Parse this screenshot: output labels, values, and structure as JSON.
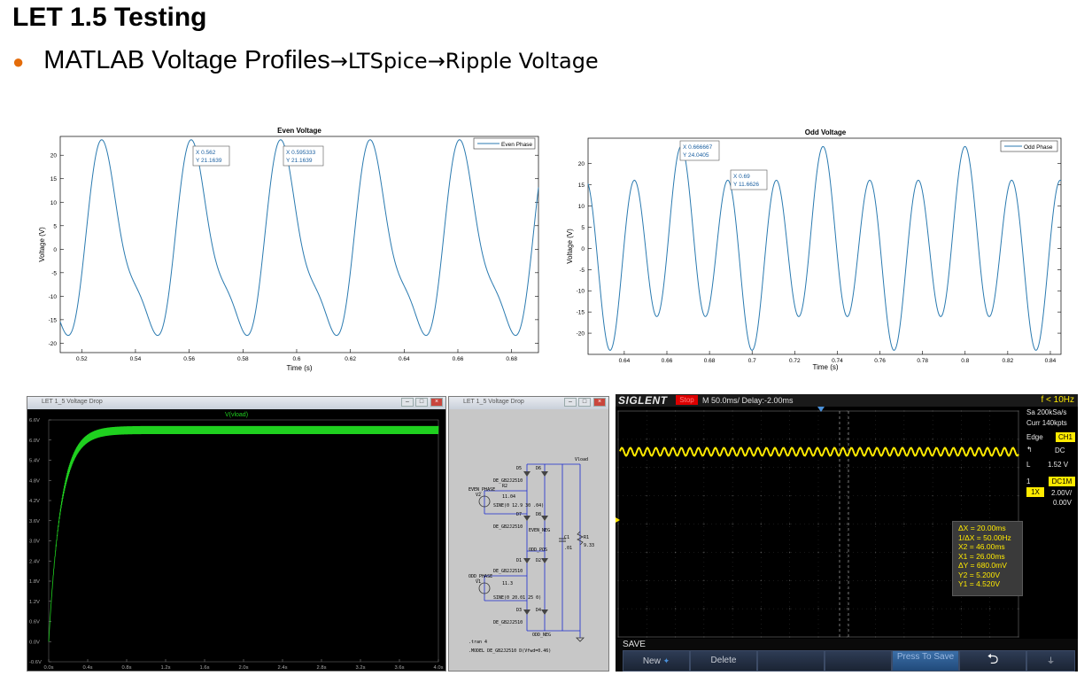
{
  "slide": {
    "title": "LET 1.5 Testing",
    "bullet_main": "MATLAB Voltage Profiles",
    "bullet_arrow1": " → ",
    "bullet_ltspice": "LTSpice",
    "bullet_arrow2": " → ",
    "bullet_ripple": "Ripple Voltage",
    "bullet_color": "#e46c0a"
  },
  "even_plot": {
    "title": "Even Voltage",
    "xlabel": "Time (s)",
    "ylabel": "Voltage (V)",
    "legend": "Even Phase",
    "xticks": [
      "0.52",
      "0.54",
      "0.56",
      "0.58",
      "0.6",
      "0.62",
      "0.64",
      "0.66",
      "0.68"
    ],
    "yticks": [
      "20",
      "15",
      "10",
      "5",
      "0",
      "-5",
      "-10",
      "-15",
      "-20"
    ],
    "datatip1_x": "X 0.562",
    "datatip1_y": "Y 21.1639",
    "datatip2_x": "X 0.595333",
    "datatip2_y": "Y 21.1639"
  },
  "odd_plot": {
    "title": "Odd Voltage",
    "xlabel": "Time (s)",
    "ylabel": "Voltage (V)",
    "legend": "Odd Phase",
    "xticks": [
      "0.64",
      "0.66",
      "0.68",
      "0.7",
      "0.72",
      "0.74",
      "0.76",
      "0.78",
      "0.8",
      "0.82",
      "0.84"
    ],
    "yticks": [
      "20",
      "15",
      "10",
      "5",
      "0",
      "-5",
      "-10",
      "-15",
      "-20"
    ],
    "datatip1_x": "X 0.666667",
    "datatip1_y": "Y 24.0405",
    "datatip2_x": "X 0.69",
    "datatip2_y": "Y 11.6626"
  },
  "chart_data": [
    {
      "type": "line",
      "title": "Even Voltage",
      "xlabel": "Time (s)",
      "ylabel": "Voltage (V)",
      "xlim": [
        0.512,
        0.69
      ],
      "ylim": [
        -22,
        24
      ],
      "series": [
        {
          "name": "Even Phase",
          "period": 0.0333,
          "peak": 21.1639,
          "peak_times": [
            0.5287,
            0.562,
            0.5953,
            0.6287,
            0.662
          ]
        }
      ],
      "datatips": [
        {
          "x": 0.562,
          "y": 21.1639
        },
        {
          "x": 0.595333,
          "y": 21.1639
        }
      ],
      "legend": "top-right",
      "grid": false
    },
    {
      "type": "line",
      "title": "Odd Voltage",
      "xlabel": "Time (s)",
      "ylabel": "Voltage (V)",
      "xlim": [
        0.623,
        0.845
      ],
      "ylim": [
        -25,
        26
      ],
      "series": [
        {
          "name": "Odd Phase",
          "major_peak": 24.0405,
          "minor_peak": 11.6626,
          "major_peak_times": [
            0.666667,
            0.7333,
            0.8
          ]
        }
      ],
      "datatips": [
        {
          "x": 0.666667,
          "y": 24.0405
        },
        {
          "x": 0.69,
          "y": 11.6626
        }
      ],
      "legend": "top-right",
      "grid": false
    },
    {
      "type": "line",
      "title": "V(vload)",
      "x_ticks": [
        "0.0s",
        "0.4s",
        "0.8s",
        "1.2s",
        "1.6s",
        "2.0s",
        "2.4s",
        "2.8s",
        "3.2s",
        "3.6s",
        "4.0s"
      ],
      "y_ticks": [
        "6.6V",
        "6.0V",
        "5.4V",
        "4.8V",
        "4.2V",
        "3.6V",
        "3.0V",
        "2.4V",
        "1.8V",
        "1.2V",
        "0.6V",
        "0.0V",
        "-0.6V"
      ],
      "xlim": [
        0,
        4.0
      ],
      "ylim": [
        -0.6,
        6.6
      ],
      "series": [
        {
          "name": "V(vload)",
          "steady_state": 6.3,
          "rise_time": 0.4
        }
      ]
    }
  ],
  "ltspice_wave": {
    "window_title": "LET 1_5 Voltage Drop",
    "trace_label": "V(vload)",
    "trace_color": "#1fd01f",
    "yticks": [
      "6.6V",
      "6.0V",
      "5.4V",
      "4.8V",
      "4.2V",
      "3.6V",
      "3.0V",
      "2.4V",
      "1.8V",
      "1.2V",
      "0.6V",
      "0.0V",
      "-0.6V"
    ],
    "xticks": [
      "0.0s",
      "0.4s",
      "0.8s",
      "1.2s",
      "1.6s",
      "2.0s",
      "2.4s",
      "2.8s",
      "3.2s",
      "3.6s",
      "4.0s"
    ]
  },
  "schematic": {
    "window_title": "LET 1_5 Voltage Drop",
    "labels": {
      "vload": "Vload",
      "d5": "D5",
      "d6": "D6",
      "de_model_1": "DE_GB2J2510",
      "de_model_1b": "DE_GB2J2510",
      "r2": "R2",
      "even_phase": "EVEN_PHASE",
      "v2": "V2",
      "v2_val": "11.04",
      "sine_even": "SINE(0 12.9 30 .04)",
      "d7": "D7",
      "d8": "D8",
      "de_model_2": "DE_GB2J2510",
      "even_neg": "EVEN_NEG",
      "c1": "C1",
      "c1_val": ".01",
      "r1": "R1",
      "r1_val": "9.33",
      "odd_pos": "ODD_POS",
      "d1": "D1",
      "d2": "D2",
      "de_model_3": "DE_GB2J2510",
      "odd_phase": "ODD_PHASE",
      "v1": "V1",
      "v1_val": "11.3",
      "sine_odd": "SINE(0 20.01 25 0)",
      "d3": "D3",
      "d4": "D4",
      "de_model_4": "DE_GB2J2510",
      "odd_neg": "ODD_NEG",
      "tran": ".tran 4",
      "model": ".MODEL DE_GB2J2510 D(Vfwd=0.46)"
    }
  },
  "scope": {
    "brand": "SIGLENT",
    "run_state": "Stop",
    "timebase": "M 50.0ms/ Delay:-2.00ms",
    "freq": "f < 10Hz",
    "sample_rate": "Sa 200kSa/s",
    "curr": "Curr 140kpts",
    "trigger_type": "Edge",
    "trigger_src": "CH1",
    "coupling": "DC",
    "trig_level": "1.52 V",
    "ch_num": "1",
    "ch_coupling": "DC1M",
    "probe": "1X",
    "vdiv": "2.00V/",
    "offset": "0.00V",
    "meas": {
      "dx": "ΔX = 20.00ms",
      "inv_dx": "1/ΔX = 50.00Hz",
      "x2": "X2 = 46.00ms",
      "x1": "X1 = 26.00ms",
      "dy": "ΔY = 680.0mV",
      "y2": "Y2 = 5.200V",
      "y1": "Y1 = 4.520V"
    },
    "menu_label": "SAVE",
    "btn_new": "New",
    "btn_delete": "Delete",
    "btn_press": "Press To Save",
    "trace_color": "#ffea00"
  }
}
